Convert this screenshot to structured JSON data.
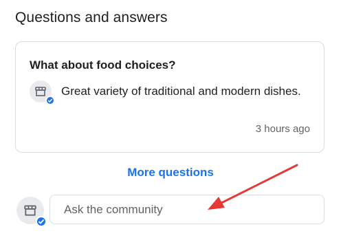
{
  "section": {
    "title": "Questions and answers"
  },
  "qa_item": {
    "question": "What about food choices?",
    "answer": "Great variety of traditional and modern dishes.",
    "timestamp": "3 hours ago",
    "avatar_icon": "store-icon",
    "badge_icon": "verified-check-icon"
  },
  "more_questions_label": "More questions",
  "ask": {
    "placeholder": "Ask the community",
    "value": ""
  },
  "colors": {
    "accent": "#1a73e8",
    "arrow": "#e53935",
    "border": "#dadce0"
  }
}
